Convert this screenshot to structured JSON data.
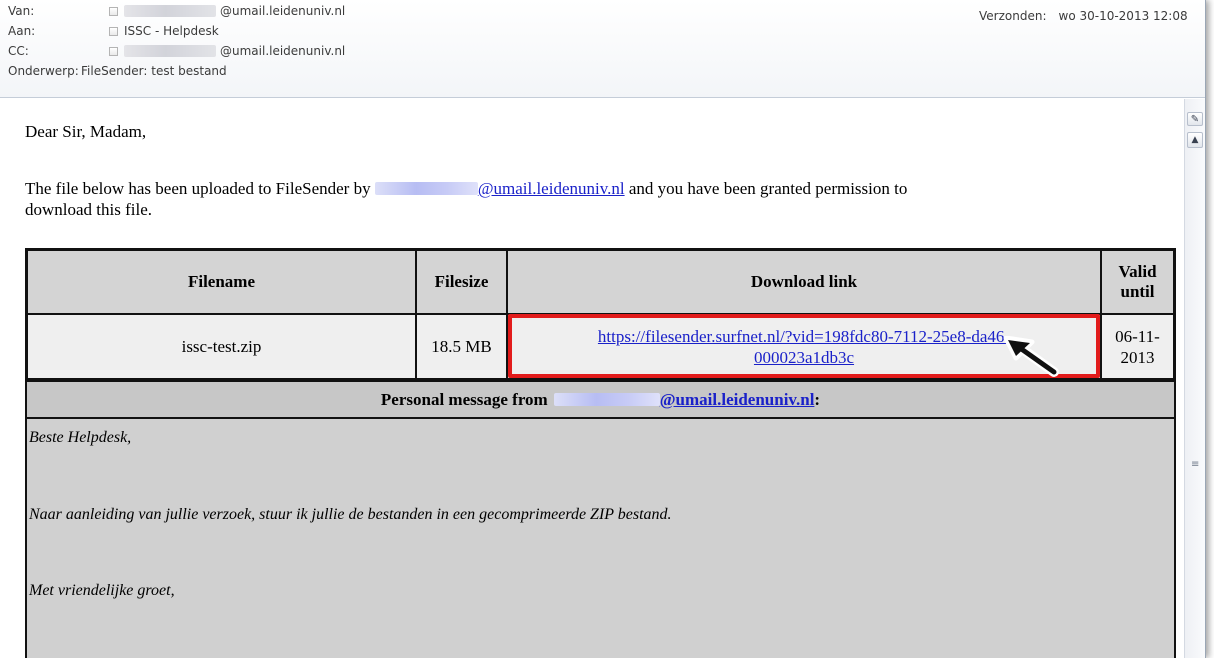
{
  "header": {
    "from_label": "Van:",
    "from_value": "@umail.leidenuniv.nl",
    "to_label": "Aan:",
    "to_value": "ISSC - Helpdesk",
    "cc_label": "CC:",
    "cc_value": "@umail.leidenuniv.nl",
    "subject_label": "Onderwerp:",
    "subject_value": "FileSender: test bestand",
    "sent_label": "Verzonden:",
    "sent_value": "wo 30-10-2013 12:08"
  },
  "body": {
    "greeting": "Dear Sir, Madam,",
    "intro_before": "The file below has been uploaded to FileSender by",
    "sender_email": "@umail.leidenuniv.nl",
    "intro_after": "and you have been granted permission to",
    "intro_line2": "download this file."
  },
  "table": {
    "headers": {
      "filename": "Filename",
      "filesize": "Filesize",
      "download": "Download link",
      "valid": "Valid until"
    },
    "row": {
      "filename": "issc-test.zip",
      "filesize": "18.5 MB",
      "link_line1": "https://filesender.surfnet.nl/?vid=198fdc80-7112-25e8-da46-",
      "link_line2": "000023a1db3c",
      "valid_line1": "06-11-",
      "valid_line2": "2013"
    },
    "personal_message_label": "Personal message from",
    "personal_message_email": "@umail.leidenuniv.nl",
    "personal_message_colon": ":"
  },
  "message": {
    "line1": "Beste Helpdesk,",
    "line2": "Naar aanleiding van jullie verzoek, stuur ik jullie de bestanden in een gecomprimeerde ZIP bestand.",
    "line3": "Met vriendelijke groet,"
  },
  "icons": {
    "annotation_arrow": "arrow-pointer-icon",
    "scroll_up": "triangle-up",
    "page_icon": "document-icon",
    "grip": "scroll-grip"
  },
  "colors": {
    "highlight_box": "#e21b1b",
    "link": "#1a21c9",
    "table_header_bg": "#d4d4d4",
    "message_bg": "#d0d0d0"
  }
}
